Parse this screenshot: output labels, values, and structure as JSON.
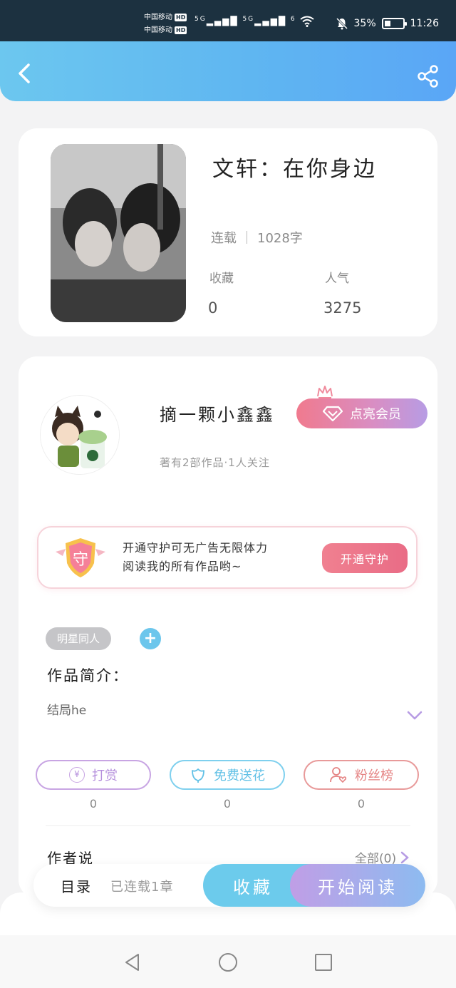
{
  "status_bar": {
    "carrier_1": "中国移动",
    "carrier_2": "中国移动",
    "hd": "HD",
    "network": "5G",
    "network2": "5G",
    "wifi_label": "6",
    "battery": "35%",
    "battery_level": 0.35,
    "time": "11:26"
  },
  "header": {
    "gradient_start": "#6cc7ef",
    "gradient_end": "#5aa6f6"
  },
  "book": {
    "title": "文轩：在你身边",
    "status": "连载",
    "word_count": "1028字",
    "favorites_label": "收藏",
    "favorites_value": "0",
    "popularity_label": "人气",
    "popularity_value": "3275"
  },
  "author": {
    "name": "摘一颗小鑫鑫",
    "meta": "著有2部作品·1人关注",
    "vip_button": "点亮会员"
  },
  "guard": {
    "shield_char": "守",
    "text_line1": "开通守护可无广告无限体力",
    "text_line2": "阅读我的所有作品哟~",
    "button": "开通守护"
  },
  "tags": {
    "tag_1": "明星同人",
    "add": "+"
  },
  "intro": {
    "title": "作品简介：",
    "text": "结局he"
  },
  "actions": {
    "reward_icon": "¥",
    "reward": "打赏",
    "reward_count": "0",
    "flower": "免费送花",
    "flower_count": "0",
    "fans": "粉丝榜",
    "fans_count": "0"
  },
  "author_say": {
    "title": "作者说",
    "all": "全部(0)"
  },
  "bottom_bar": {
    "toc": "目录",
    "serial": "已连载1章",
    "collect": "收藏",
    "read": "开始阅读"
  },
  "colors": {
    "accent_blue": "#6ccbec",
    "accent_pink": "#f07a8e",
    "accent_purple": "#b79ce4"
  }
}
